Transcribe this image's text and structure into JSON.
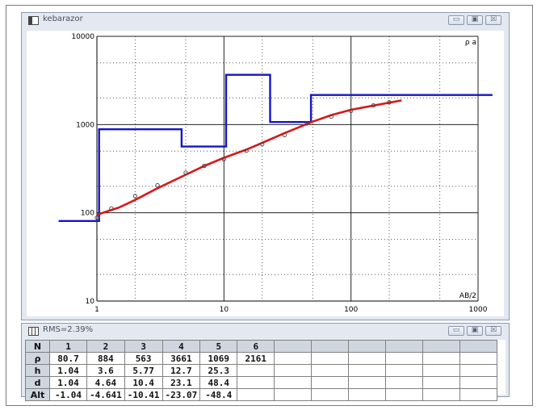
{
  "window_main": {
    "title": "kebarazor"
  },
  "window_table": {
    "title": "RMS=2.39%"
  },
  "window_controls": {
    "minimize": "▭",
    "maximize": "▣",
    "close": "☒"
  },
  "chart_data": {
    "type": "line",
    "xscale": "log",
    "yscale": "log",
    "xlim": [
      1,
      1000
    ],
    "ylim": [
      10,
      10000
    ],
    "x_ticks": [
      "1",
      "10",
      "100",
      "1000"
    ],
    "y_ticks": [
      "10",
      "100",
      "1000",
      "10000"
    ],
    "xlabel": "AB/2",
    "ylabel": "ρ a",
    "grid": true,
    "series": [
      {
        "name": "",
        "style": "step",
        "color": "#1414c8",
        "points": [
          [
            0.5,
            80.7
          ],
          [
            1.04,
            80.7
          ],
          [
            1.04,
            884
          ],
          [
            4.64,
            884
          ],
          [
            4.64,
            563
          ],
          [
            10.4,
            563
          ],
          [
            10.4,
            3661
          ],
          [
            23.1,
            3661
          ],
          [
            23.1,
            1069
          ],
          [
            48.4,
            1069
          ],
          [
            48.4,
            2161
          ],
          [
            1300,
            2161
          ]
        ]
      },
      {
        "name": "",
        "style": "line",
        "color": "#d81818",
        "x": [
          1,
          1.5,
          2,
          3,
          5,
          7,
          10,
          15,
          20,
          30,
          50,
          70,
          100,
          150,
          250
        ],
        "y": [
          95,
          115,
          140,
          190,
          270,
          340,
          420,
          520,
          620,
          800,
          1080,
          1280,
          1470,
          1640,
          1880
        ]
      },
      {
        "name": "",
        "style": "markers",
        "color": "#444444",
        "x": [
          1,
          1.3,
          2,
          3,
          5,
          7,
          10,
          15,
          20,
          30,
          45,
          70,
          100,
          150,
          200
        ],
        "y": [
          88,
          112,
          155,
          205,
          285,
          340,
          405,
          505,
          600,
          760,
          1030,
          1230,
          1430,
          1650,
          1790
        ]
      }
    ]
  },
  "table": {
    "row_labels": [
      "N",
      "ρ",
      "h",
      "d",
      "Alt"
    ],
    "columns": [
      "1",
      "2",
      "3",
      "4",
      "5",
      "6",
      "",
      "",
      "",
      "",
      "",
      ""
    ],
    "rows": [
      [
        "80.7",
        "884",
        "563",
        "3661",
        "1069",
        "2161",
        "",
        "",
        "",
        "",
        "",
        ""
      ],
      [
        "1.04",
        "3.6",
        "5.77",
        "12.7",
        "25.3",
        "",
        "",
        "",
        "",
        "",
        "",
        ""
      ],
      [
        "1.04",
        "4.64",
        "10.4",
        "23.1",
        "48.4",
        "",
        "",
        "",
        "",
        "",
        "",
        ""
      ],
      [
        "-1.04",
        "-4.641",
        "-10.41",
        "-23.07",
        "-48.4",
        "",
        "",
        "",
        "",
        "",
        "",
        ""
      ]
    ]
  }
}
